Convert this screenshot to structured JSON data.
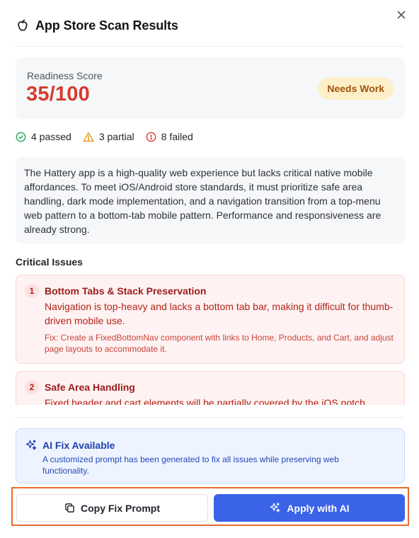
{
  "dialog": {
    "title": "App Store Scan Results",
    "close_icon": "close-icon",
    "app_icon": "apple-icon"
  },
  "score": {
    "label": "Readiness Score",
    "value": "35/100",
    "badge": "Needs Work",
    "value_color": "#d63b2f",
    "badge_color": "#fdf0c9"
  },
  "stats": {
    "passed": "4 passed",
    "partial": "3 partial",
    "failed": "8 failed"
  },
  "summary": "The Hattery app is a high-quality web experience but lacks critical native mobile affordances. To meet iOS/Android store standards, it must prioritize safe area handling, dark mode implementation, and a navigation transition from a top-menu web pattern to a bottom-tab mobile pattern. Performance and responsiveness are already strong.",
  "critical": {
    "heading": "Critical Issues",
    "issues": [
      {
        "number": "1",
        "title": "Bottom Tabs & Stack Preservation",
        "description": "Navigation is top-heavy and lacks a bottom tab bar, making it difficult for thumb-driven mobile use.",
        "fix": "Fix: Create a FixedBottomNav component with links to Home, Products, and Cart, and adjust page layouts to accommodate it."
      },
      {
        "number": "2",
        "title": "Safe Area Handling",
        "description": "Fixed header and cart elements will be partially covered by the iOS notch",
        "fix": ""
      }
    ]
  },
  "ai_fix": {
    "title": "AI Fix Available",
    "description": "A customized prompt has been generated to fix all issues while preserving web functionality.",
    "icon": "sparkles-icon",
    "accent": "#1e40af"
  },
  "actions": {
    "copy_label": "Copy Fix Prompt",
    "apply_label": "Apply with AI",
    "apply_color": "#3b63e8",
    "highlight_color": "#ea6a2d"
  }
}
